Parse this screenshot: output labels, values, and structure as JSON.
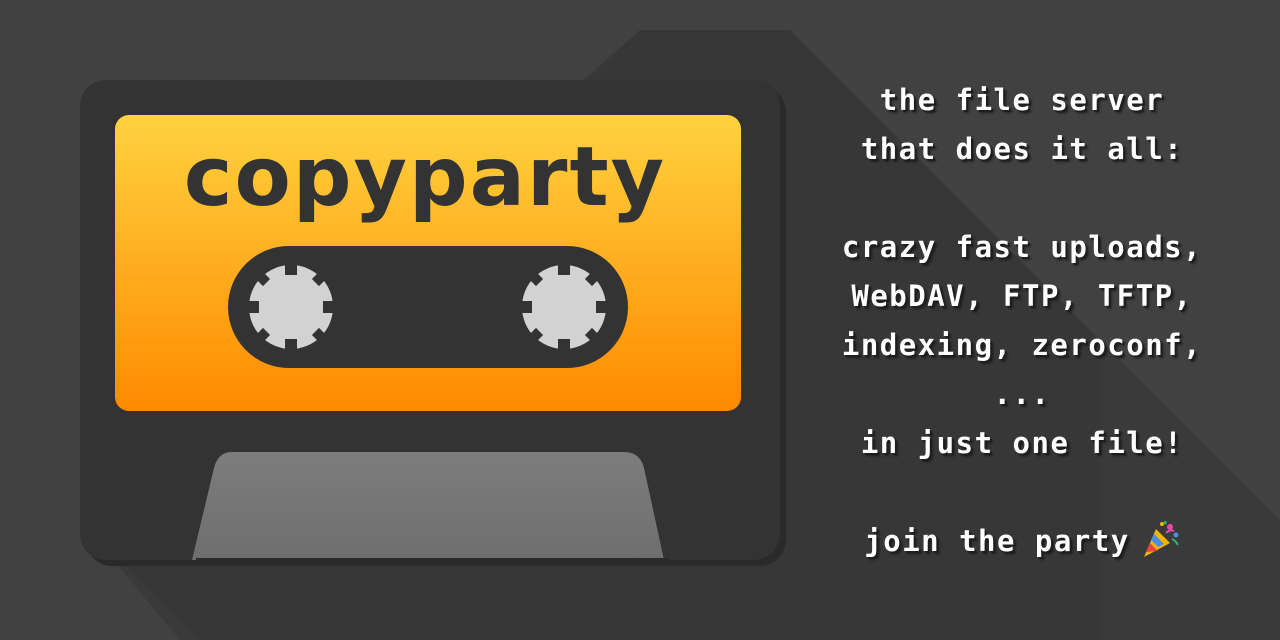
{
  "brand": {
    "name": "copyparty"
  },
  "tagline": {
    "line1": "the file server",
    "line2": "that does it all:",
    "line3": "crazy fast uploads,",
    "line4": "WebDAV, FTP, TFTP,",
    "line5": "indexing, zeroconf,",
    "line6": "...",
    "line7": "in just one file!",
    "cta": "join the party"
  },
  "icons": {
    "cassette": "cassette-tape-icon",
    "party": "party-popper-icon"
  },
  "colors": {
    "background": "#414141",
    "cassette_body": "#333333",
    "label_top": "#ffd23f",
    "label_bottom": "#ff8c00",
    "reel": "#d2d2d2",
    "tape_window": "#333333",
    "bottom_plate": "#777777",
    "text": "#ffffff"
  }
}
